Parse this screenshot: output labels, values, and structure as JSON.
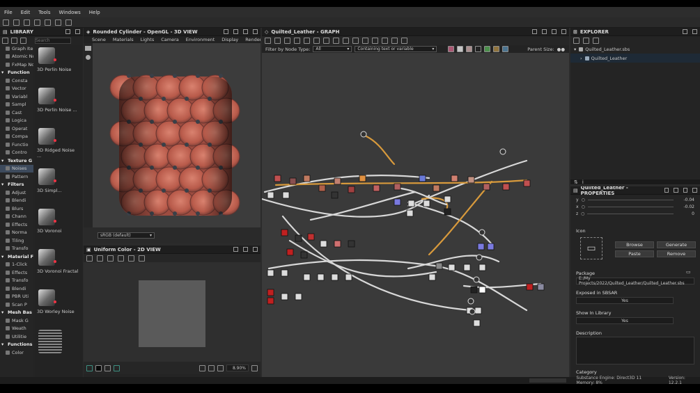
{
  "menu": [
    "File",
    "Edit",
    "Tools",
    "Windows",
    "Help"
  ],
  "library": {
    "title": "LIBRARY",
    "search_placeholder": "Search",
    "tree": [
      {
        "label": "Graph Item",
        "hdr": false
      },
      {
        "label": "Atomic Nod",
        "hdr": false
      },
      {
        "label": "FxMap No",
        "hdr": false
      },
      {
        "label": "Function",
        "hdr": true
      },
      {
        "label": "Consta",
        "hdr": false
      },
      {
        "label": "Vector",
        "hdr": false
      },
      {
        "label": "Variabl",
        "hdr": false
      },
      {
        "label": "Sampl",
        "hdr": false
      },
      {
        "label": "Cast",
        "hdr": false
      },
      {
        "label": "Logica",
        "hdr": false
      },
      {
        "label": "Operat",
        "hdr": false
      },
      {
        "label": "Compa",
        "hdr": false
      },
      {
        "label": "Functio",
        "hdr": false
      },
      {
        "label": "Contro",
        "hdr": false
      },
      {
        "label": "Texture G",
        "hdr": true
      },
      {
        "label": "Noises",
        "hdr": false,
        "sel": true
      },
      {
        "label": "Pattern",
        "hdr": false
      },
      {
        "label": "Filters",
        "hdr": true
      },
      {
        "label": "Adjust",
        "hdr": false
      },
      {
        "label": "Blendi",
        "hdr": false
      },
      {
        "label": "Blurs",
        "hdr": false
      },
      {
        "label": "Chann",
        "hdr": false
      },
      {
        "label": "Effects",
        "hdr": false
      },
      {
        "label": "Norma",
        "hdr": false
      },
      {
        "label": "Tiling",
        "hdr": false
      },
      {
        "label": "Transfo",
        "hdr": false
      },
      {
        "label": "Material F",
        "hdr": true
      },
      {
        "label": "1-Click",
        "hdr": false
      },
      {
        "label": "Effects",
        "hdr": false
      },
      {
        "label": "Transfo",
        "hdr": false
      },
      {
        "label": "Blendi",
        "hdr": false
      },
      {
        "label": "PBR Uti",
        "hdr": false
      },
      {
        "label": "Scan P",
        "hdr": false
      },
      {
        "label": "Mesh Bas",
        "hdr": true
      },
      {
        "label": "Mask G",
        "hdr": false
      },
      {
        "label": "Weath",
        "hdr": false
      },
      {
        "label": "Utilitie",
        "hdr": false
      },
      {
        "label": "Functions",
        "hdr": true
      },
      {
        "label": "Color",
        "hdr": false
      }
    ],
    "thumbs": [
      "3D Perlin Noise",
      "3D Perlin Noise ...",
      "3D Ridged Noise ...",
      "3D Simpl...",
      "3D Voronoi",
      "3D Voronoi Fractal",
      "3D Worley Noise",
      ""
    ]
  },
  "view3d": {
    "title": "Rounded Cylinder - OpenGL - 3D VIEW",
    "menu": [
      "Scene",
      "Materials",
      "Lights",
      "Camera",
      "Environment",
      "Display",
      "Renderer"
    ],
    "colorspace": "sRGB (default)"
  },
  "view2d": {
    "title": "Uniform Color - 2D VIEW",
    "zoom": "8.90%"
  },
  "graph": {
    "title": "Quilted_Leather - GRAPH",
    "filter_label": "Filter by Node Type:",
    "filter_value": "All",
    "text_filter": "Containing text or variable",
    "parent_size_label": "Parent Size:"
  },
  "explorer": {
    "title": "EXPLORER",
    "package": "Quilted_Leather.sbs",
    "graph": "Quilted_Leather"
  },
  "properties": {
    "title": "Quilted_Leather - PROPERTIES",
    "rows": [
      {
        "axis": "y",
        "value": "-0.04"
      },
      {
        "axis": "x",
        "value": "-0.02"
      },
      {
        "axis": "z",
        "value": "0"
      }
    ],
    "icon_label": "Icon",
    "browse": "Browse",
    "generate": "Generate",
    "paste": "Paste",
    "remove": "Remove",
    "package_label": "Package",
    "package_path": "E:/My Projects/2022/Quilted_Leather/Quilted_Leather.sbs",
    "exposed_label": "Exposed in SBSAR",
    "exposed_value": "Yes",
    "show_label": "Show In Library",
    "show_value": "Yes",
    "description_label": "Description",
    "category_label": "Category"
  },
  "status": {
    "engine": "Substance Engine: Direct3D 11 Memory: 8%",
    "version": "Version: 12.2.1"
  }
}
